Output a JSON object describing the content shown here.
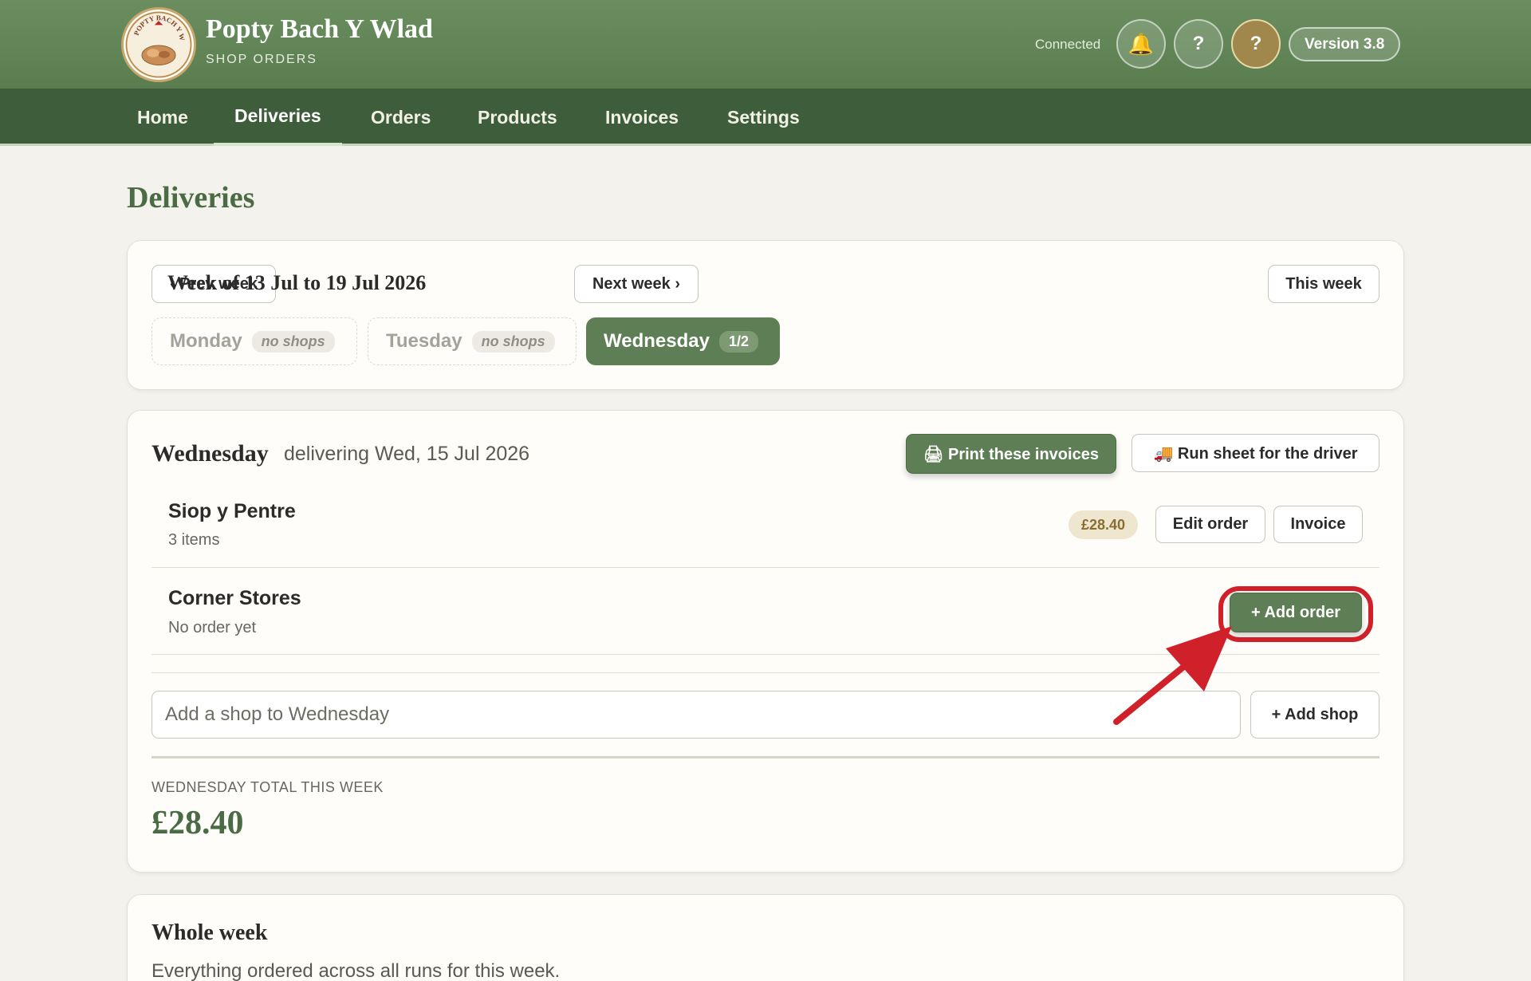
{
  "brand": {
    "title": "Popty Bach Y Wlad",
    "subtitle": "SHOP ORDERS",
    "logo_text": "POPTY BACH Y WLAD"
  },
  "header": {
    "status": "Connected",
    "bell_icon": "🔔",
    "help1": "?",
    "help2": "?",
    "version": "Version 3.8"
  },
  "nav": [
    "Home",
    "Deliveries",
    "Orders",
    "Products",
    "Invoices",
    "Settings"
  ],
  "page_title": "Deliveries",
  "week": {
    "prev": "‹ Prev week",
    "label": "Week of 13 Jul to 19 Jul 2026",
    "next": "Next week ›",
    "this_week": "This week",
    "days": [
      {
        "name": "Monday",
        "pill": "no shops"
      },
      {
        "name": "Tuesday",
        "pill": "no shops"
      },
      {
        "name": "Wednesday",
        "pill": "1/2"
      }
    ]
  },
  "day": {
    "heading": "Wednesday",
    "sub": "delivering Wed, 15 Jul 2026",
    "print_btn": "🖨 Print these invoices",
    "runsheet_btn": "🚚 Run sheet for the driver",
    "shops": [
      {
        "name": "Siop y Pentre",
        "meta": "3 items",
        "price": "£28.40",
        "edit": "Edit order",
        "invoice": "Invoice"
      },
      {
        "name": "Corner Stores",
        "meta": "No order yet",
        "add": "+ Add order"
      }
    ],
    "add_shop_placeholder": "Add a shop to Wednesday",
    "add_shop_btn": "+ Add shop",
    "total_label": "WEDNESDAY TOTAL THIS WEEK",
    "total_value": "£28.40"
  },
  "whole_week": {
    "title": "Whole week",
    "desc": "Everything ordered across all runs for this week."
  },
  "colors": {
    "brand_green": "#5e7f55",
    "nav_dark": "#3e5d3a",
    "highlight_red": "#d0202a"
  }
}
